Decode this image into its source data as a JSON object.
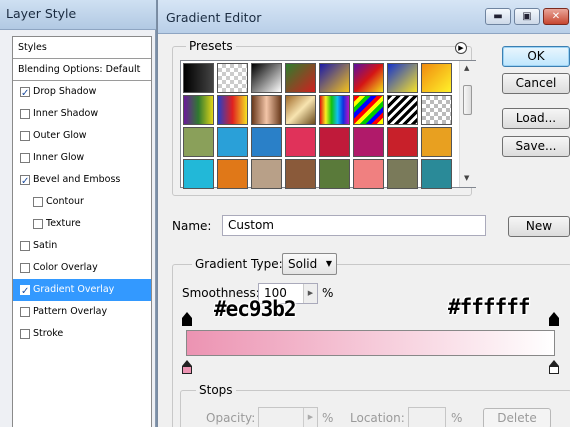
{
  "layer_style": {
    "title": "Layer Style",
    "items": [
      {
        "label": "Styles",
        "kind": "head"
      },
      {
        "label": "Blending Options: Default",
        "kind": "head"
      },
      {
        "label": "Drop Shadow",
        "checked": true
      },
      {
        "label": "Inner Shadow",
        "checked": false
      },
      {
        "label": "Outer Glow",
        "checked": false
      },
      {
        "label": "Inner Glow",
        "checked": false
      },
      {
        "label": "Bevel and Emboss",
        "checked": true
      },
      {
        "label": "Contour",
        "checked": false,
        "sub": true
      },
      {
        "label": "Texture",
        "checked": false,
        "sub": true
      },
      {
        "label": "Satin",
        "checked": false
      },
      {
        "label": "Color Overlay",
        "checked": false
      },
      {
        "label": "Gradient Overlay",
        "checked": true,
        "selected": true
      },
      {
        "label": "Pattern Overlay",
        "checked": false
      },
      {
        "label": "Stroke",
        "checked": false
      }
    ]
  },
  "gradient_editor": {
    "title": "Gradient Editor",
    "title_buttons": {
      "minimize": "▬",
      "maximize": "▣",
      "close": "✕"
    },
    "presets_label": "Presets",
    "buttons": {
      "ok": "OK",
      "cancel": "Cancel",
      "load": "Load...",
      "save": "Save...",
      "new": "New",
      "delete": "Delete"
    },
    "name_label": "Name:",
    "name_value": "Custom",
    "gradient_type_label": "Gradient Type:",
    "gradient_type_value": "Solid",
    "smoothness_label": "Smoothness:",
    "smoothness_value": "100",
    "percent": "%",
    "stops_label": "Stops",
    "opacity_label": "Opacity:",
    "location_label": "Location:",
    "annotations": {
      "left": "#ec93b2",
      "right": "#ffffff"
    },
    "gradient_start_color": "#ec93b2",
    "gradient_end_color": "#ffffff"
  },
  "presets": [
    "linear-gradient(90deg,#000,#444)",
    "repeating-conic-gradient(#ccc 0 25%,#fff 0 50%) 0 0/8px 8px",
    "linear-gradient(135deg,#000,#fff)",
    "linear-gradient(135deg,#2d7d2d,#d11f1f)",
    "linear-gradient(135deg,#1a1aa8,#f4c21e)",
    "linear-gradient(135deg,#5b0fa0,#d41515,#f3e11a)",
    "linear-gradient(135deg,#1533cc,#f7e22a)",
    "linear-gradient(135deg,#f08b0f,#fff22a)",
    "linear-gradient(90deg,#6b1a9a,#2f7a2f,#e0d418)",
    "linear-gradient(90deg,#2540c8,#e02020,#f4e020)",
    "linear-gradient(90deg,#6a3a1c,#f3c5a8,#6a3a1c)",
    "linear-gradient(135deg,#a06a2a,#f7e4b0,#6a4a1a)",
    "linear-gradient(90deg,#e01010,#f7f020,#10c010,#10c0f0,#1030e0,#c010c0)",
    "repeating-linear-gradient(135deg,#f00 0 4px,#ff0 4px 8px,#0c0 8px 12px,#00f 12px 16px)",
    "repeating-linear-gradient(135deg,#000 0 3px,#fff 3px 6px)",
    "repeating-conic-gradient(#bbb 0 25%,#fff 0 50%) 0 0/8px 8px",
    "#8aa05a",
    "#2aa0d8",
    "#2a80c8",
    "#e0325a",
    "#c01a3a",
    "#b01a6a",
    "#c8202a",
    "#e8a020",
    "#22b8d8",
    "#e07818",
    "#b8a088",
    "#8a5a3a",
    "#5a7a3a",
    "#f08080",
    "#7a7a5a",
    "#2a8a98"
  ]
}
